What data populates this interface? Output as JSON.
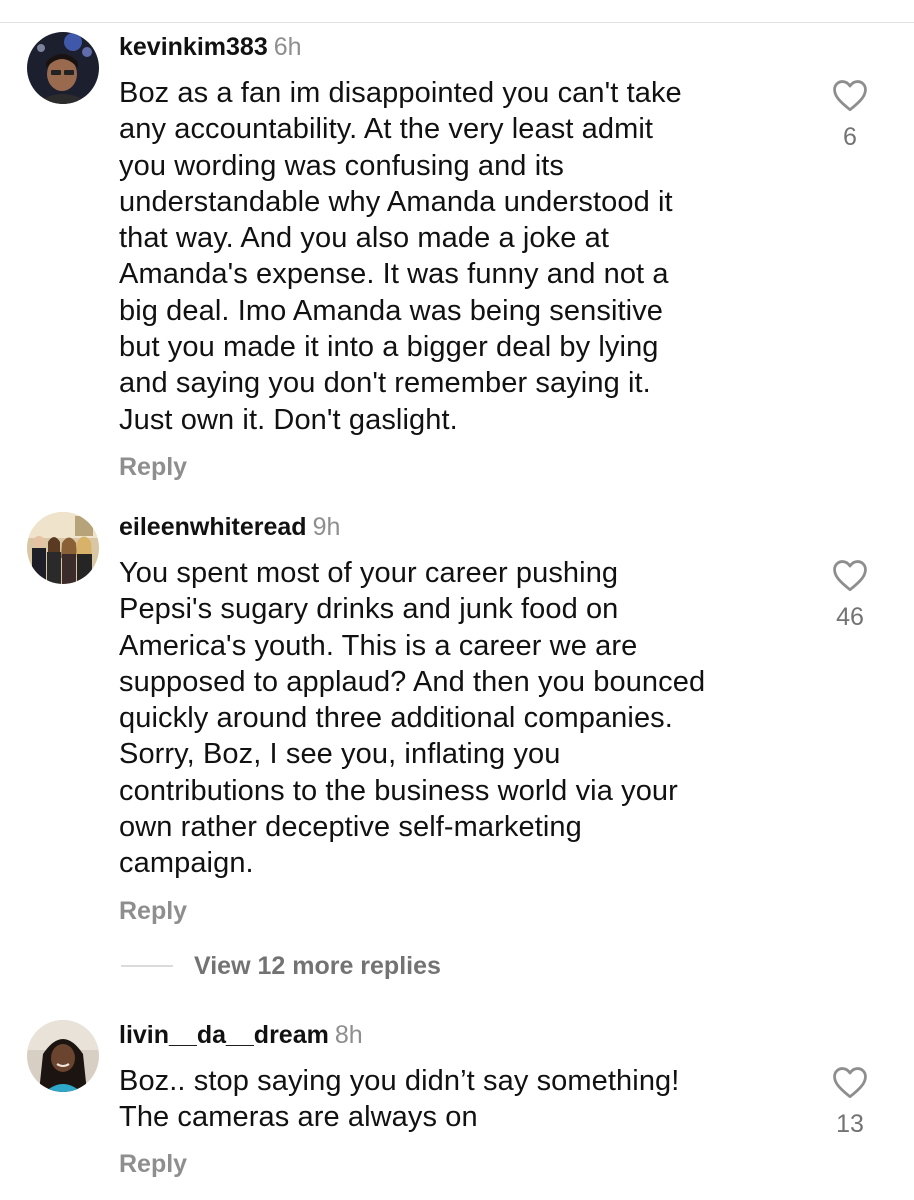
{
  "comments": [
    {
      "username": "kevinkim383",
      "time": "6h",
      "lines": [
        "Boz as a fan im disappointed you can't take",
        "any accountability. At the very least admit",
        "you wording was confusing and its",
        "understandable why Amanda understood it",
        "that way. And you also made a joke at",
        "Amanda's expense. It was funny and not a",
        "big deal. Imo Amanda was being sensitive",
        "but you made it into a bigger deal by lying",
        "and saying you don't remember saying it.",
        "Just own it. Don't gaslight."
      ],
      "likes": "6",
      "reply_label": "Reply"
    },
    {
      "username": "eileenwhiteread",
      "time": "9h",
      "lines": [
        "You spent most of your career pushing",
        "Pepsi's sugary drinks and junk food on",
        "America's youth. This is a career we are",
        "supposed to applaud? And then you bounced",
        "quickly around three additional companies.",
        "Sorry, Boz, I see you, inflating you",
        "contributions to the business world via your",
        "own rather deceptive self-marketing",
        "campaign."
      ],
      "likes": "46",
      "reply_label": "Reply"
    },
    {
      "username": "livin__da__dream",
      "time": "8h",
      "lines": [
        "Boz.. stop saying you didn’t say something!",
        "The cameras are always on"
      ],
      "likes": "13",
      "reply_label": "Reply"
    }
  ],
  "view_more_replies": "View 12 more replies",
  "icons": {
    "like": "heart-outline-icon",
    "avatar": "avatar-photo"
  },
  "colors": {
    "text": "#111111",
    "muted": "#8e8e8e",
    "like_count": "#737373",
    "divider": "#dbdbdb"
  }
}
